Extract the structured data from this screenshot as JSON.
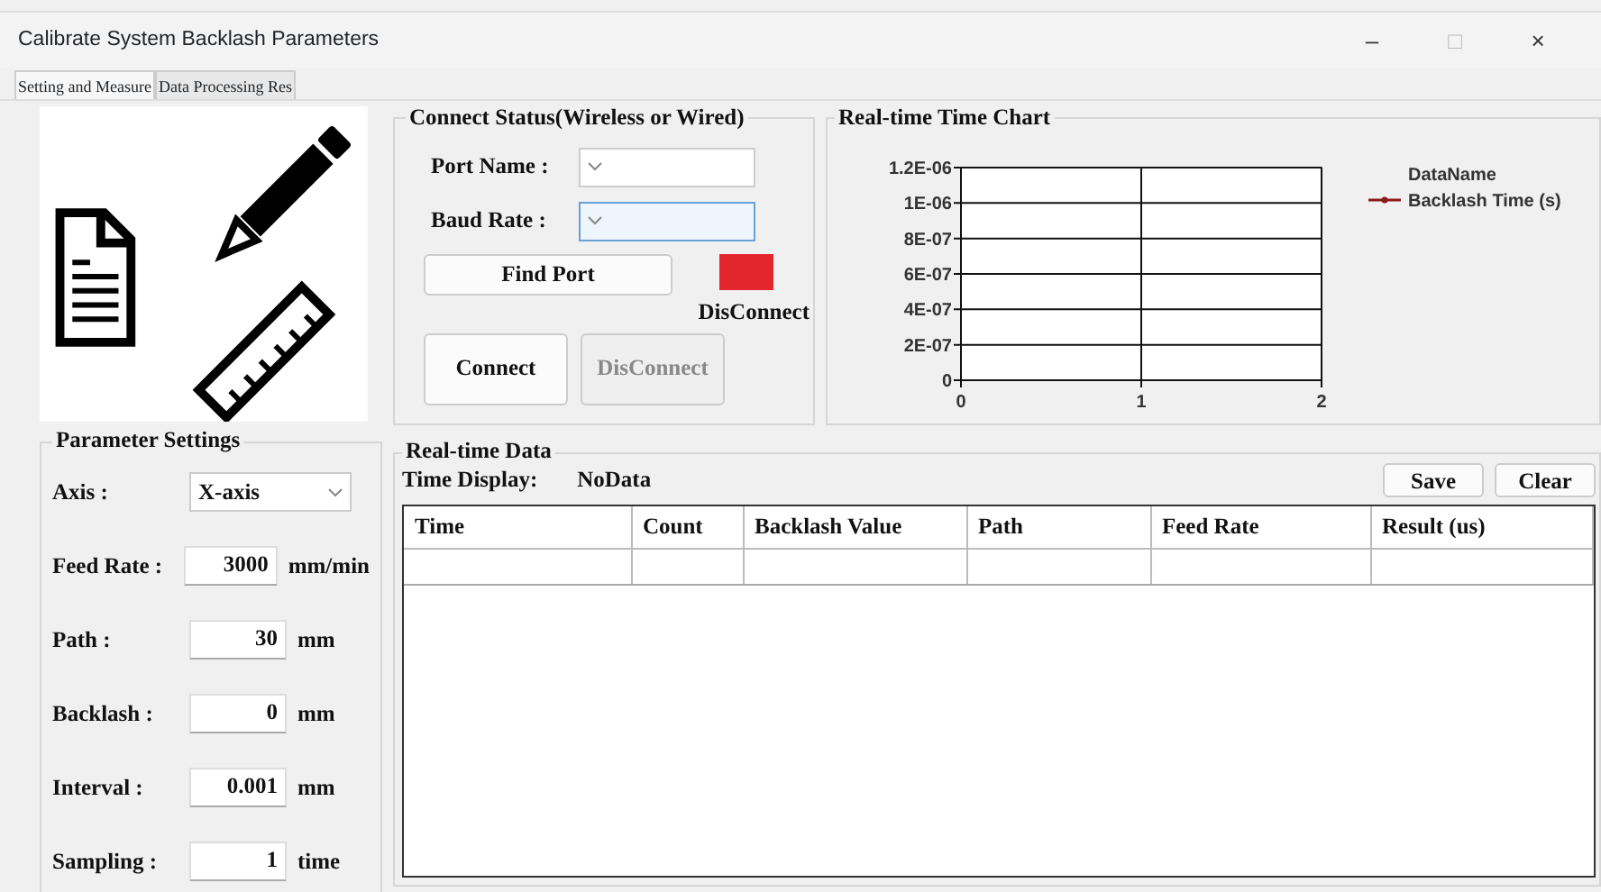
{
  "window": {
    "title": "Calibrate System Backlash Parameters",
    "controls": [
      "–",
      "□",
      "×"
    ]
  },
  "tabs": [
    {
      "label": "Setting and Measure",
      "selected": true
    },
    {
      "label": "Data Processing Res",
      "selected": false
    }
  ],
  "parameter_settings": {
    "title": "Parameter Settings",
    "axis": {
      "label": "Axis :",
      "value": "X-axis"
    },
    "fields": [
      {
        "label": "Feed Rate :",
        "value": "3000",
        "unit": "mm/min"
      },
      {
        "label": "Path :",
        "value": "30",
        "unit": "mm"
      },
      {
        "label": "Backlash :",
        "value": "0",
        "unit": "mm"
      },
      {
        "label": "Interval :",
        "value": "0.001",
        "unit": "mm"
      },
      {
        "label": "Sampling :",
        "value": "1",
        "unit": "time"
      }
    ]
  },
  "connect_status": {
    "title": "Connect Status(Wireless or Wired)",
    "dropdowns": [
      {
        "label": "Port Name :",
        "focused": false
      },
      {
        "label": "Baud Rate :",
        "focused": true
      }
    ],
    "find_port": "Find Port",
    "status": {
      "label": "DisConnect",
      "color": "#e3262d"
    },
    "buttons": [
      {
        "label": "Connect",
        "disabled": false
      },
      {
        "label": "DisConnect",
        "disabled": true
      }
    ]
  },
  "chart_panel": {
    "title": "Real-time Time Chart",
    "legend_title": "DataName",
    "chart_data": {
      "type": "line",
      "categories": [
        "0",
        "1",
        "2"
      ],
      "grid": true,
      "ylim": [
        0,
        1.2e-06
      ],
      "yticks": [
        {
          "value": 0,
          "label": "0"
        },
        {
          "value": 2e-07,
          "label": "2E-07"
        },
        {
          "value": 4e-07,
          "label": "4E-07"
        },
        {
          "value": 6e-07,
          "label": "6E-07"
        },
        {
          "value": 8e-07,
          "label": "8E-07"
        },
        {
          "value": 1e-06,
          "label": "1E-06"
        },
        {
          "value": 1.2e-06,
          "label": "1.2E-06"
        }
      ],
      "series": [
        {
          "name": "Backlash Time (s)",
          "color": "#8b1a1a",
          "values": [
            null,
            null,
            null
          ]
        }
      ]
    }
  },
  "realtime_data": {
    "title": "Real-time Data",
    "time_display": {
      "label": "Time Display:",
      "value": "NoData"
    },
    "buttons": [
      "Save",
      "Clear"
    ],
    "table": {
      "columns": [
        "Time",
        "Count",
        "Backlash Value",
        "Path",
        "Feed Rate",
        "Result (us)"
      ]
    }
  }
}
